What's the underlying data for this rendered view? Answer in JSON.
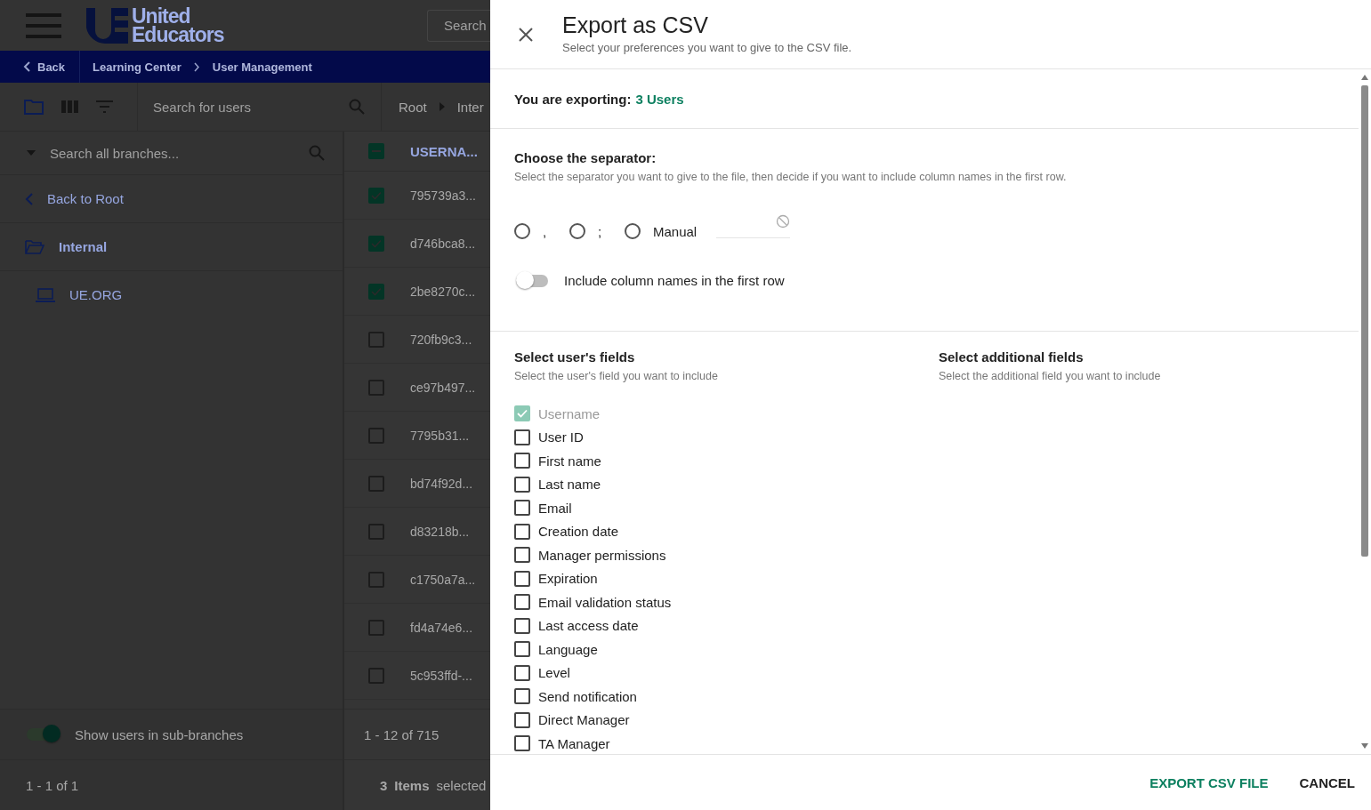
{
  "app": {
    "logo_line1": "United",
    "logo_line2": "Educators",
    "search_placeholder": "Search"
  },
  "nav": {
    "back": "Back",
    "crumbs": [
      "Learning Center",
      "User Management"
    ]
  },
  "toolbar": {
    "search_placeholder": "Search for users",
    "path": [
      "Root",
      "Inter"
    ]
  },
  "branches": {
    "search_placeholder": "Search all branches...",
    "back": "Back to Root",
    "items": [
      {
        "label": "Internal",
        "kind": "folder"
      },
      {
        "label": "UE.ORG",
        "kind": "device"
      }
    ],
    "show_sub": {
      "label": "Show users in sub-branches",
      "on": true
    },
    "pager": "1 - 1 of 1"
  },
  "users": {
    "column": "USERNA...",
    "indeterminate": true,
    "rows": [
      {
        "username": "795739a3...",
        "selected": true
      },
      {
        "username": "d746bca8...",
        "selected": true
      },
      {
        "username": "2be8270c...",
        "selected": true
      },
      {
        "username": "720fb9c3...",
        "selected": false
      },
      {
        "username": "ce97b497...",
        "selected": false
      },
      {
        "username": "7795b31...",
        "selected": false
      },
      {
        "username": "bd74f92d...",
        "selected": false
      },
      {
        "username": "d83218b...",
        "selected": false
      },
      {
        "username": "c1750a7a...",
        "selected": false
      },
      {
        "username": "fd4a74e6...",
        "selected": false
      },
      {
        "username": "5c953ffd-...",
        "selected": false
      }
    ],
    "pager": "1 - 12 of 715",
    "selection": {
      "count": "3",
      "label": "Items",
      "suffix": "selected"
    }
  },
  "dialog": {
    "title": "Export as CSV",
    "subtitle": "Select your preferences you want to give to the CSV file.",
    "exporting": {
      "label": "You are exporting:",
      "value": "3 Users"
    },
    "separator": {
      "title": "Choose the separator:",
      "description": "Select the separator you want to give to the file, then decide if you want to include column names in the first row.",
      "options": [
        {
          "label": ",",
          "selected": false
        },
        {
          "label": ";",
          "selected": false
        },
        {
          "label": "Manual",
          "selected": false
        }
      ]
    },
    "include_names": {
      "label": "Include column names in the first row",
      "on": false
    },
    "user_fields": {
      "title": "Select user's fields",
      "description": "Select the user's field you want to include",
      "items": [
        {
          "label": "Username",
          "checked": true,
          "disabled": true
        },
        {
          "label": "User ID",
          "checked": false,
          "disabled": false
        },
        {
          "label": "First name",
          "checked": false,
          "disabled": false
        },
        {
          "label": "Last name",
          "checked": false,
          "disabled": false
        },
        {
          "label": "Email",
          "checked": false,
          "disabled": false
        },
        {
          "label": "Creation date",
          "checked": false,
          "disabled": false
        },
        {
          "label": "Manager permissions",
          "checked": false,
          "disabled": false
        },
        {
          "label": "Expiration",
          "checked": false,
          "disabled": false
        },
        {
          "label": "Email validation status",
          "checked": false,
          "disabled": false
        },
        {
          "label": "Last access date",
          "checked": false,
          "disabled": false
        },
        {
          "label": "Language",
          "checked": false,
          "disabled": false
        },
        {
          "label": "Level",
          "checked": false,
          "disabled": false
        },
        {
          "label": "Send notification",
          "checked": false,
          "disabled": false
        },
        {
          "label": "Direct Manager",
          "checked": false,
          "disabled": false
        },
        {
          "label": "TA Manager",
          "checked": false,
          "disabled": false
        }
      ]
    },
    "additional_fields": {
      "title": "Select additional fields",
      "description": "Select the additional field you want to include"
    },
    "actions": {
      "export": "EXPORT CSV FILE",
      "cancel": "CANCEL"
    }
  }
}
